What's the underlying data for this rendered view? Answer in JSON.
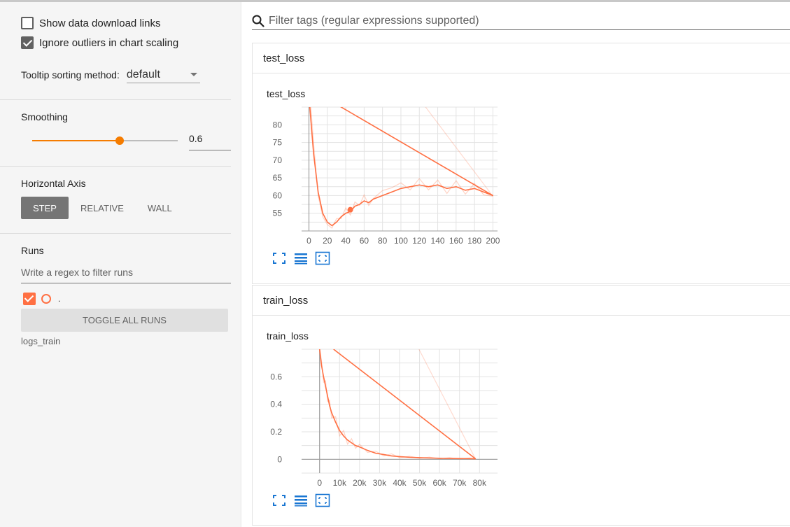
{
  "sidebar": {
    "show_download_label": "Show data download links",
    "show_download_checked": false,
    "ignore_outliers_label": "Ignore outliers in chart scaling",
    "ignore_outliers_checked": true,
    "tooltip_label": "Tooltip sorting method:",
    "tooltip_value": "default",
    "smoothing_title": "Smoothing",
    "smoothing_value": "0.6",
    "smoothing_fraction": 0.6,
    "horizontal_axis_title": "Horizontal Axis",
    "axis_options": [
      "STEP",
      "RELATIVE",
      "WALL"
    ],
    "axis_selected": "STEP",
    "runs_title": "Runs",
    "runs_filter_placeholder": "Write a regex to filter runs",
    "run_label": ".",
    "toggle_all_label": "TOGGLE ALL RUNS",
    "run_dir": "logs_train"
  },
  "search": {
    "placeholder": "Filter tags (regular expressions supported)"
  },
  "colors": {
    "accent": "#f57c00",
    "run": "#ff7043",
    "icon_blue": "#1976d2"
  },
  "cards": [
    {
      "header": "test_loss",
      "chart_title": "test_loss"
    },
    {
      "header": "train_loss",
      "chart_title": "train_loss"
    }
  ],
  "chart_data": [
    {
      "type": "line",
      "title": "test_loss",
      "x_ticks": [
        0,
        20,
        40,
        60,
        80,
        100,
        120,
        140,
        160,
        180,
        200
      ],
      "y_ticks": [
        55,
        60,
        65,
        70,
        75,
        80
      ],
      "xlim": [
        -8,
        205
      ],
      "ylim": [
        50,
        85
      ],
      "series": [
        {
          "x": [
            0,
            5,
            10,
            15,
            20,
            25,
            30,
            35,
            40,
            45,
            50,
            55,
            60,
            65,
            70,
            80,
            90,
            100,
            110,
            120,
            130,
            140,
            150,
            160,
            170,
            180,
            190,
            200
          ],
          "y": [
            88,
            72,
            61,
            55,
            52.5,
            51.5,
            52.5,
            54,
            55,
            55.5,
            57,
            57.5,
            58.5,
            58,
            59,
            60,
            61,
            62,
            62.5,
            63,
            62.5,
            63,
            62,
            62.5,
            61.5,
            62,
            61,
            60
          ],
          "raw_y": [
            92,
            75,
            60,
            54,
            51.8,
            50.8,
            53.5,
            53.5,
            56.5,
            54.5,
            58.2,
            57.2,
            60.2,
            57.2,
            59.2,
            61.4,
            62.2,
            63.6,
            61.6,
            64.8,
            61.6,
            64.4,
            60.6,
            64.2,
            60.4,
            63.4,
            60.2,
            59.8
          ]
        }
      ],
      "highlight_point": {
        "x": 45,
        "y": 56
      }
    },
    {
      "type": "line",
      "title": "train_loss",
      "x_ticks": [
        "0",
        "10k",
        "20k",
        "30k",
        "40k",
        "50k",
        "60k",
        "70k",
        "80k"
      ],
      "x_tick_values": [
        0,
        10000,
        20000,
        30000,
        40000,
        50000,
        60000,
        70000,
        80000
      ],
      "y_ticks": [
        0,
        0.2,
        0.4,
        0.6
      ],
      "xlim": [
        -9000,
        89000
      ],
      "ylim": [
        -0.1,
        0.8
      ],
      "series": [
        {
          "x": [
            0,
            1000,
            2000,
            3000,
            4000,
            5000,
            6000,
            8000,
            10000,
            12000,
            14000,
            16000,
            18000,
            20000,
            24000,
            28000,
            32000,
            36000,
            40000,
            45000,
            50000,
            55000,
            60000,
            65000,
            70000,
            75000,
            78000
          ],
          "y": [
            0.8,
            0.68,
            0.6,
            0.53,
            0.46,
            0.39,
            0.34,
            0.27,
            0.21,
            0.17,
            0.14,
            0.12,
            0.1,
            0.09,
            0.065,
            0.045,
            0.035,
            0.025,
            0.02,
            0.015,
            0.012,
            0.01,
            0.008,
            0.007,
            0.006,
            0.005,
            0.004
          ],
          "raw_y": [
            0.82,
            0.71,
            0.56,
            0.57,
            0.42,
            0.43,
            0.3,
            0.31,
            0.17,
            0.21,
            0.11,
            0.15,
            0.08,
            0.11,
            0.05,
            0.06,
            0.025,
            0.04,
            0.012,
            0.022,
            0.008,
            0.016,
            0.004,
            0.012,
            0.002,
            0.01,
            0.003
          ]
        }
      ]
    }
  ]
}
